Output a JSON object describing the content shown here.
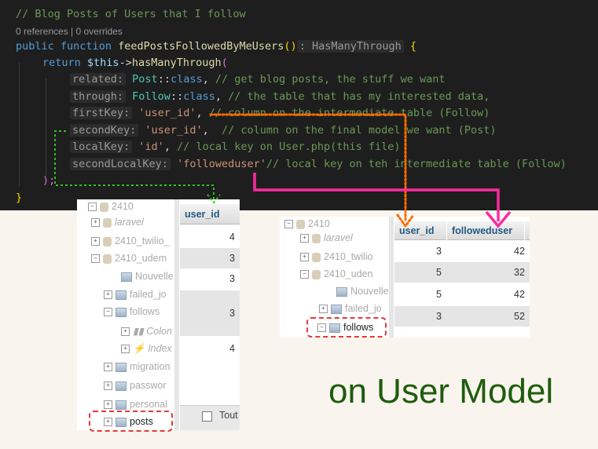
{
  "code": {
    "comment": "// Blog Posts of Users that I follow",
    "codelens": "0 references | 0 overrides",
    "kw_public": "public",
    "kw_function": "function",
    "fn_name": "feedPostsFollowedByMeUsers",
    "paren_open": "(",
    "paren_close": ")",
    "colon": ":",
    "return_type": "HasManyThrough",
    "brace_open": "{",
    "kw_return": "return",
    "this_var": "$this",
    "arrow": "->",
    "method": "hasManyThrough",
    "lines": [
      {
        "label": "related:",
        "cls": "Post",
        "sep": "::",
        "kw": "class",
        "comma": ",",
        "comment": "// get blog posts, the stuff we want"
      },
      {
        "label": "through:",
        "cls": "Follow",
        "sep": "::",
        "kw": "class",
        "comma": ",",
        "comment": "// the table that has my interested data,"
      },
      {
        "label": "firstKey:",
        "str": "'user_id'",
        "comma": ",",
        "comment": "// column on the intermediate table (Follow)"
      },
      {
        "label": "secondKey:",
        "str": "'user_id'",
        "comma": ",",
        "comment": "// column on the final model we want (Post)"
      },
      {
        "label": "localKey:",
        "str": "'id'",
        "comma": ",",
        "comment": "// local key on User.php(this file)"
      },
      {
        "label": "secondLocalKey:",
        "str": "'followeduser'",
        "comment": "// local key on teh intermediate table (Follow)"
      }
    ],
    "close_call": ");",
    "close_brace": "}"
  },
  "left_panel": {
    "tree": [
      {
        "label": "2410"
      },
      {
        "label": "laravel"
      },
      {
        "label": "2410_twilio_"
      },
      {
        "label": "2410_udem"
      },
      {
        "label": "Nouvelle"
      },
      {
        "label": "failed_jo"
      },
      {
        "label": "follows"
      },
      {
        "label": "Colon"
      },
      {
        "label": "Index"
      },
      {
        "label": "migration"
      },
      {
        "label": "passwor"
      },
      {
        "label": "personal"
      },
      {
        "label": "posts"
      }
    ],
    "column_header": "user_id",
    "values": [
      "4",
      "3",
      "3",
      "3",
      "4"
    ],
    "footer_label": "Tout"
  },
  "right_panel": {
    "tree": [
      {
        "label": "2410"
      },
      {
        "label": "laravel"
      },
      {
        "label": "2410_twilio"
      },
      {
        "label": "2410_uden"
      },
      {
        "label": "Nouvelle"
      },
      {
        "label": "failed_jo"
      },
      {
        "label": "follows"
      }
    ],
    "headers": [
      "user_id",
      "followeduser",
      "c"
    ],
    "rows": [
      {
        "user_id": "3",
        "followeduser": "4",
        "extra": "2"
      },
      {
        "user_id": "5",
        "followeduser": "3",
        "extra": "2"
      },
      {
        "user_id": "5",
        "followeduser": "4",
        "extra": "2"
      },
      {
        "user_id": "3",
        "followeduser": "5",
        "extra": "2"
      }
    ]
  },
  "caption": "on User Model",
  "colors": {
    "editor_bg": "#1e1e1e",
    "arrow_orange": "#ff6a00",
    "arrow_magenta": "#ff2aa0",
    "arrow_green": "#2fc21a",
    "highlight_box": "#e8383d",
    "caption": "#1e5c0c"
  }
}
